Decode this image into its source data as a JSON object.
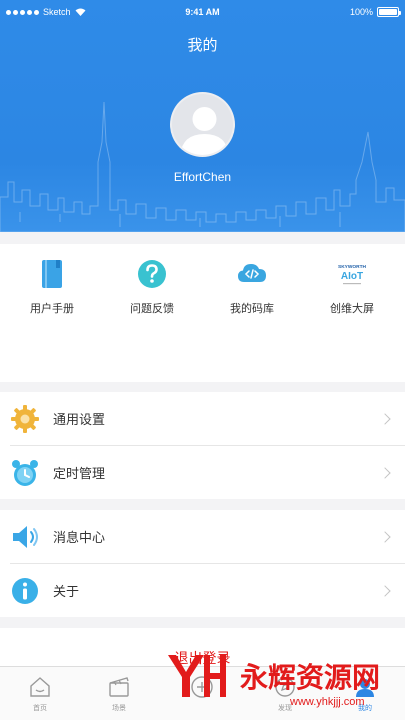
{
  "status_bar": {
    "carrier": "Sketch",
    "time": "9:41 AM",
    "battery": "100%"
  },
  "header": {
    "title": "我的",
    "username": "EffortChen"
  },
  "quick_actions": [
    {
      "label": "用户手册",
      "icon": "book-icon",
      "color": "#3aa3e6"
    },
    {
      "label": "问题反馈",
      "icon": "question-icon",
      "color": "#39c2d0"
    },
    {
      "label": "我的码库",
      "icon": "cloud-code-icon",
      "color": "#3aa6e0"
    },
    {
      "label": "创维大屏",
      "icon": "skyworth-logo",
      "logo_top": "SKYWORTH",
      "logo_main": "AIoT"
    }
  ],
  "settings_group_1": [
    {
      "label": "通用设置",
      "icon": "gear-icon",
      "color": "#f0b43a"
    },
    {
      "label": "定时管理",
      "icon": "alarm-clock-icon",
      "color": "#3ab4e8"
    }
  ],
  "settings_group_2": [
    {
      "label": "消息中心",
      "icon": "speaker-icon",
      "color": "#3aa6e6"
    },
    {
      "label": "关于",
      "icon": "info-icon",
      "color": "#3ab0e8"
    }
  ],
  "logout": {
    "label": "退出登录",
    "color": "#e21b1b"
  },
  "tabbar": [
    {
      "label": "首页",
      "icon": "home-icon",
      "active": false
    },
    {
      "label": "场景",
      "icon": "scene-icon",
      "active": false
    },
    {
      "label": "",
      "icon": "add-icon",
      "active": false
    },
    {
      "label": "发现",
      "icon": "discover-icon",
      "active": false
    },
    {
      "label": "我的",
      "icon": "profile-icon",
      "active": true
    }
  ],
  "watermark": {
    "text": "永辉资源网",
    "url": "www.yhkjjj.com"
  },
  "colors": {
    "primary": "#2c86e3",
    "background": "#f3f3f5",
    "danger": "#e21b1b"
  }
}
